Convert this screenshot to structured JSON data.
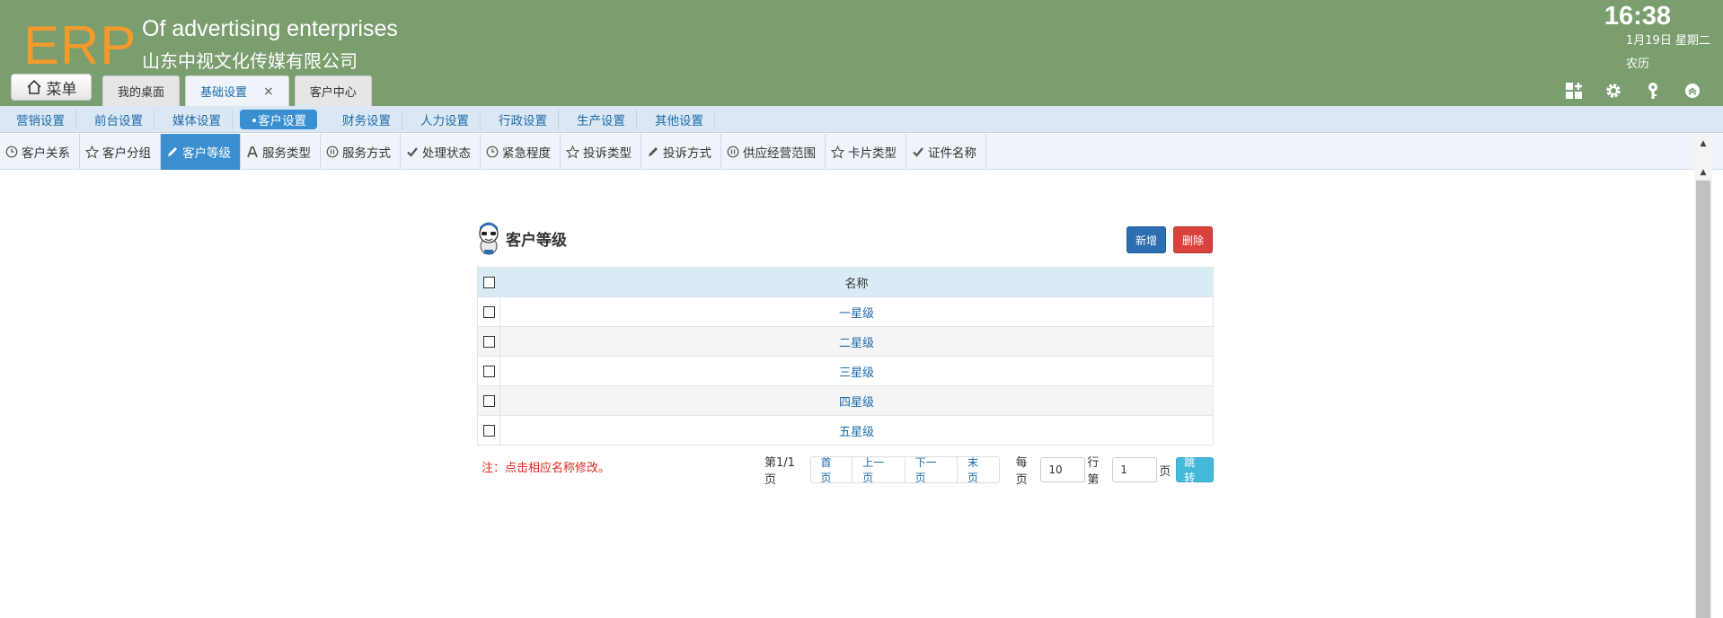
{
  "header": {
    "logo": "ERP",
    "company_en": "Of advertising enterprises",
    "company_cn": "山东中视文化传媒有限公司",
    "time": "16:38",
    "date": "1月19日 星期二",
    "lunar": "农历",
    "bg_color": "#7b9e6f",
    "logo_color": "#f39a2d",
    "menu_label": "菜单",
    "tabs": [
      {
        "label": "我的桌面",
        "active": false
      },
      {
        "label": "基础设置",
        "active": true,
        "close": "×"
      },
      {
        "label": "客户中心",
        "active": false
      }
    ],
    "icons": [
      "dashboard-icon",
      "gear-icon",
      "key-icon",
      "collapse-up-icon"
    ]
  },
  "module_nav": {
    "items": [
      "营销设置",
      "前台设置",
      "媒体设置",
      "•客户设置",
      "财务设置",
      "人力设置",
      "行政设置",
      "生产设置",
      "其他设置"
    ],
    "active_index": 3
  },
  "sub_nav": {
    "items": [
      {
        "label": "客户关系",
        "icon": "clock-icon"
      },
      {
        "label": "客户分组",
        "icon": "star-icon"
      },
      {
        "label": "客户等级",
        "icon": "pencil-icon"
      },
      {
        "label": "服务类型",
        "icon": "font-icon"
      },
      {
        "label": "服务方式",
        "icon": "pause-icon"
      },
      {
        "label": "处理状态",
        "icon": "check-icon"
      },
      {
        "label": "紧急程度",
        "icon": "clock-icon"
      },
      {
        "label": "投诉类型",
        "icon": "star-icon"
      },
      {
        "label": "投诉方式",
        "icon": "pencil-icon"
      },
      {
        "label": "供应经营范围",
        "icon": "pause-icon"
      },
      {
        "label": "卡片类型",
        "icon": "star-icon"
      },
      {
        "label": "证件名称",
        "icon": "check-icon"
      }
    ],
    "active_index": 2
  },
  "panel": {
    "title": "客户等级",
    "new_label": "新增",
    "delete_label": "删除",
    "column_name": "名称",
    "rows": [
      "一星级",
      "二星级",
      "三星级",
      "四星级",
      "五星级"
    ],
    "note": "注：点击相应名称修改。"
  },
  "pager": {
    "page_info": "第1/1页",
    "first": "首页",
    "prev": "上一页",
    "next": "下一页",
    "last": "末页",
    "per_page_label": "每页",
    "per_page_value": "10",
    "rows_label": "行第",
    "page_value": "1",
    "page_label": "页",
    "go_label": "跳转"
  }
}
